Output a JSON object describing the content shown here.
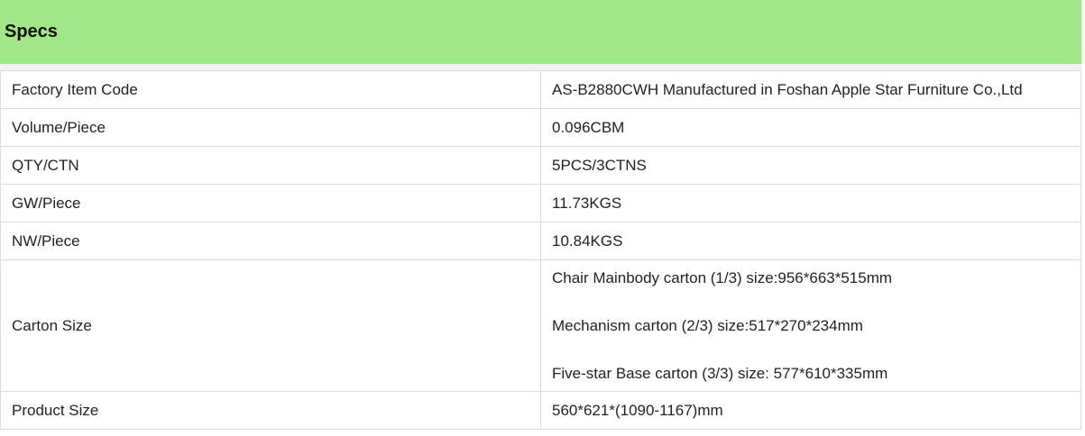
{
  "header": {
    "title": "Specs",
    "background_color": "#a2e68a"
  },
  "specs": {
    "rows": [
      {
        "label": "Factory Item Code",
        "value": "AS-B2880CWH  Manufactured in Foshan Apple Star Furniture Co.,Ltd"
      },
      {
        "label": "Volume/Piece",
        "value": "0.096CBM"
      },
      {
        "label": "QTY/CTN",
        "value": "5PCS/3CTNS"
      },
      {
        "label": "GW/Piece",
        "value": "11.73KGS"
      },
      {
        "label": "NW/Piece",
        "value": "10.84KGS"
      },
      {
        "label": "Carton Size",
        "lines": [
          "Chair Mainbody carton (1/3) size:956*663*515mm",
          "Mechanism carton (2/3) size:517*270*234mm",
          "Five-star Base carton (3/3) size: 577*610*335mm"
        ]
      },
      {
        "label": "Product Size",
        "value": "560*621*(1090-1167)mm"
      }
    ]
  }
}
